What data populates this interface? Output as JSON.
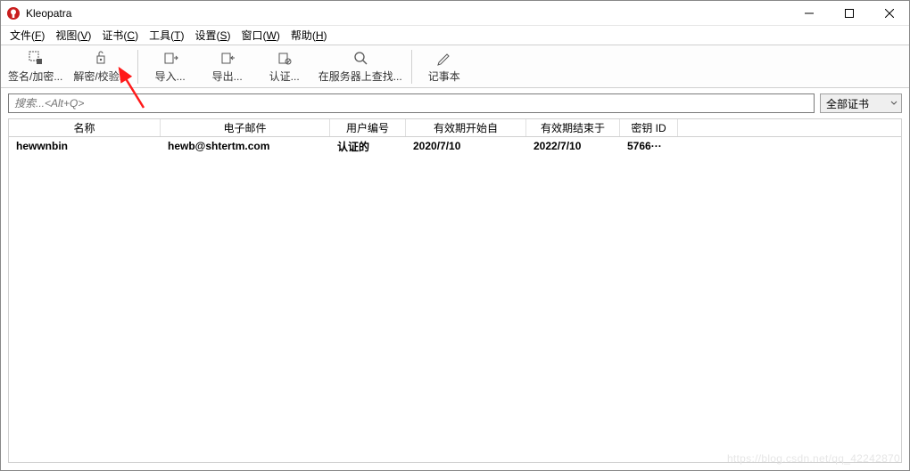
{
  "titlebar": {
    "title": "Kleopatra"
  },
  "menu": {
    "file": {
      "label": "文件",
      "hotkey": "F"
    },
    "view": {
      "label": "视图",
      "hotkey": "V"
    },
    "cert": {
      "label": "证书",
      "hotkey": "C"
    },
    "tools": {
      "label": "工具",
      "hotkey": "T"
    },
    "settings": {
      "label": "设置",
      "hotkey": "S"
    },
    "window": {
      "label": "窗口",
      "hotkey": "W"
    },
    "help": {
      "label": "帮助",
      "hotkey": "H"
    }
  },
  "toolbar": {
    "sign": "签名/加密...",
    "decrypt": "解密/校验...",
    "import": "导入...",
    "export": "导出...",
    "certify": "认证...",
    "lookup": "在服务器上查找...",
    "notepad": "记事本"
  },
  "search": {
    "placeholder": "搜索...<Alt+Q>",
    "filter": "全部证书"
  },
  "columns": {
    "name": "名称",
    "email": "电子邮件",
    "user": "用户编号",
    "start": "有效期开始自",
    "end": "有效期结束于",
    "keyid": "密钥 ID"
  },
  "rows": [
    {
      "name": "hewwnbin",
      "email": "hewb@shtertm.com",
      "user": "认证的",
      "start": "2020/7/10",
      "end": "2022/7/10",
      "keyid": "5766···"
    }
  ],
  "watermark": "https://blog.csdn.net/qq_42242870"
}
